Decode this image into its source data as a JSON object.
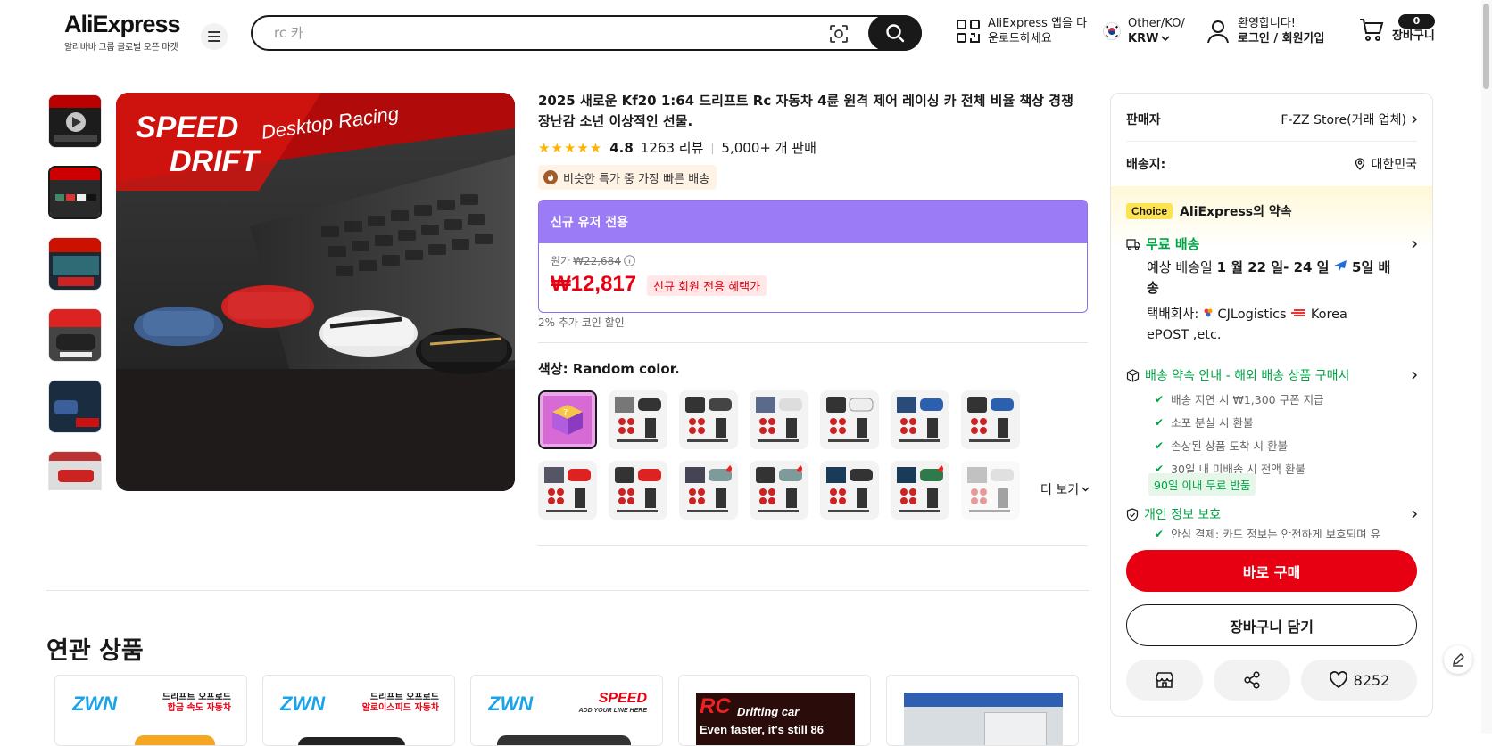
{
  "header": {
    "logo": "AliExpress",
    "logo_sub": "알리바바 그룹 글로벌 오픈 마켓",
    "search_placeholder": "rc 카",
    "app_line1": "AliExpress 앱을 다",
    "app_line2": "운로드하세요",
    "region_line1": "Other/KO/",
    "region_line2": "KRW",
    "account_line1": "환영합니다!",
    "account_line2": "로그인 / 회원가입",
    "cart_count": "0",
    "cart_label": "장바구니"
  },
  "product": {
    "title": "2025 새로운 Kf20 1:64 드리프트 Rc 자동차 4륜 원격 제어 레이싱 카 전체 비율 책상 경쟁 장난감 소년 이상적인 선물.",
    "stars": "★★★★★",
    "rating": "4.8",
    "reviews": "1263 리뷰",
    "sold": "5,000+ 개 판매",
    "fast_badge": "비슷한 특가 중 가장 빠른 배송",
    "main_image_text1": "SPEED",
    "main_image_text2": "DRIFT",
    "main_image_text3": "Desktop Racing"
  },
  "price": {
    "new_user_label": "신규 유저 전용",
    "orig_label": "원가",
    "orig_value": "₩22,684",
    "current": "₩12,817",
    "tag": "신규 회원 전용 혜택가",
    "coin": "2% 추가 코인 할인"
  },
  "color": {
    "label": "색상: ",
    "value": "Random color.",
    "more": "더 보기"
  },
  "panel": {
    "seller_label": "판매자",
    "seller_value": "F-ZZ Store(거래 업체)",
    "ship_label": "배송지:",
    "ship_value": "대한민국",
    "choice_tag": "Choice",
    "choice_text": "AliExpress의 약속",
    "free_shipping": "무료 배송",
    "delivery_line1": "예상 배송일",
    "delivery_date": "1 월 22 일- 24 일",
    "delivery_days": "5일 배",
    "delivery_line2": "송",
    "carrier_label": "택배회사:",
    "carrier1": "CJLogistics",
    "carrier2": "Korea",
    "carrier_line2": "ePOST ,etc.",
    "promise_title": "배송 약속 안내 - 해외 배송 상품 구매시",
    "promise_items": [
      "배송 지연 시 ₩1,300 쿠폰 지급",
      "소포 분실 시 환불",
      "손상된 상품 도착 시 환불",
      "30일 내 미배송 시 전액 환불"
    ],
    "free_return": "90일 이내 무료 반품",
    "privacy_title": "개인 정보 보호",
    "privacy_text": "안심 결제: 카드 정보는 안전하게 보호되며 유",
    "buy_now": "바로 구매",
    "add_cart": "장바구니 담기",
    "wish_count": "8252"
  },
  "related": {
    "title": "연관 상품",
    "cards": [
      {
        "brand": "ZWN",
        "caption1": "드리프트 오프로드",
        "caption2": "합금 속도 자동차"
      },
      {
        "brand": "ZWN",
        "caption1": "드리프트 오프로드",
        "caption2": "알로이스피드 자동차"
      },
      {
        "brand": "ZWN",
        "caption1": "SPEED",
        "caption2": "ADD YOUR LINE HERE"
      },
      {
        "brand": "RC",
        "caption1": "Drifting car",
        "caption2": "Even faster, it's still 86"
      },
      {
        "brand": "",
        "caption1": "",
        "caption2": ""
      }
    ]
  },
  "colors": {
    "accent_red": "#e60012",
    "purple": "#9b7bf6",
    "choice_yellow": "#fde251",
    "green": "#00a445",
    "star": "#fdb400"
  }
}
